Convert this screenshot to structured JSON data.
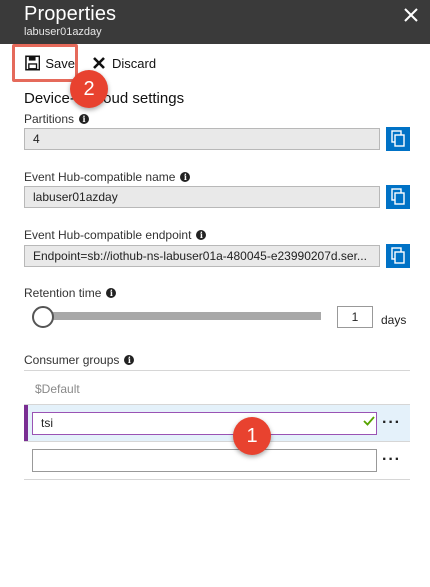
{
  "header": {
    "title": "Properties",
    "subtitle": "labuser01azday"
  },
  "toolbar": {
    "save_label": "Save",
    "discard_label": "Discard"
  },
  "annotations": {
    "badge_save": "2",
    "badge_consumer": "1"
  },
  "section": {
    "heading": "Device-to-cloud settings"
  },
  "fields": {
    "partitions": {
      "label": "Partitions",
      "value": "4"
    },
    "event_hub_name": {
      "label": "Event Hub-compatible name",
      "value": "labuser01azday"
    },
    "event_hub_endpoint": {
      "label": "Event Hub-compatible endpoint",
      "value": "Endpoint=sb://iothub-ns-labuser01a-480045-e23990207d.ser..."
    }
  },
  "retention": {
    "label": "Retention time",
    "value": "1",
    "unit": "days",
    "slider_fraction": 0.0
  },
  "consumer_groups": {
    "label": "Consumer groups",
    "default_item": "$Default",
    "items": [
      {
        "value": "tsi"
      },
      {
        "value": ""
      }
    ]
  },
  "colors": {
    "titlebar": "#3a3a3a",
    "accent": "#0072c6",
    "badge": "#e8422f",
    "active_bar": "#7a2e93",
    "check": "#57a300"
  },
  "icons": {
    "close": "close-icon",
    "save": "floppy-disk-icon",
    "discard": "x-icon",
    "copy": "copy-icon",
    "info": "info-icon",
    "check": "checkmark-icon",
    "more": "ellipsis-icon"
  }
}
